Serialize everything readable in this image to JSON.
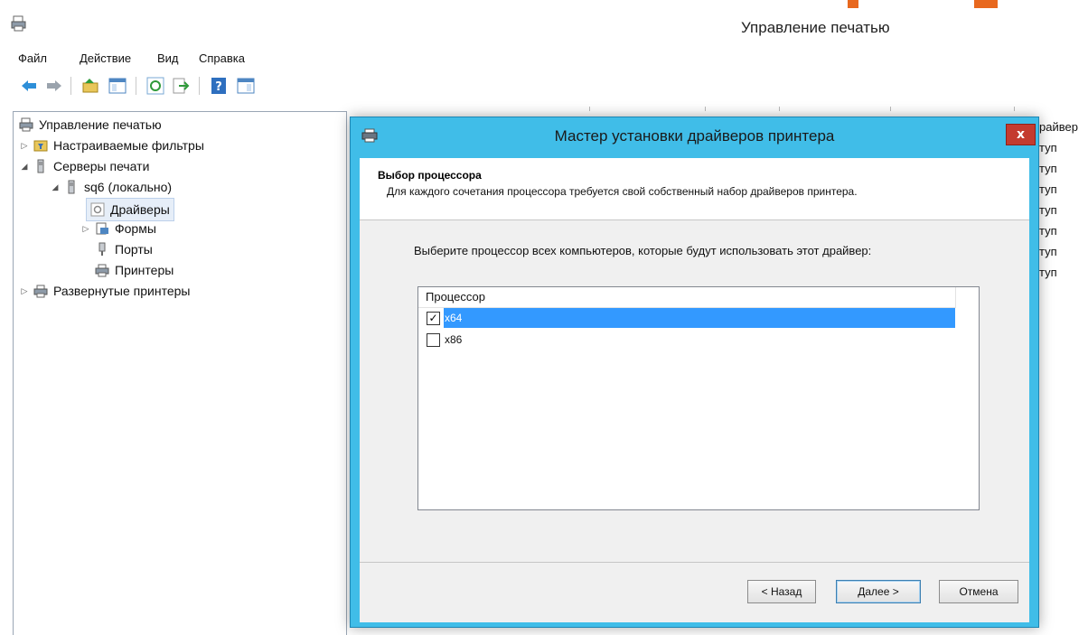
{
  "window": {
    "title": "Управление печатью"
  },
  "menu": [
    "Файл",
    "Действие",
    "Вид",
    "Справка"
  ],
  "tree": {
    "root": "Управление печатью",
    "custom_filters": "Настраиваемые фильтры",
    "print_servers": "Серверы печати",
    "server": "sq6 (локально)",
    "drivers": "Драйверы",
    "forms": "Формы",
    "ports": "Порты",
    "printers": "Принтеры",
    "deployed_printers": "Развернутые принтеры"
  },
  "right_column": {
    "header_fragment": "райвер",
    "rows": [
      "туп",
      "туп",
      "туп",
      "туп",
      "туп",
      "туп",
      "туп"
    ]
  },
  "dialog": {
    "title": "Мастер установки драйверов принтера",
    "close_label": "x",
    "section_title": "Выбор процессора",
    "section_desc": "Для каждого сочетания процессора требуется свой собственный набор драйверов принтера.",
    "instruction": "Выберите процессор всех компьютеров, которые будут использовать этот драйвер:",
    "list_header": "Процессор",
    "options": [
      {
        "label": "x64",
        "checked": true,
        "selected": true
      },
      {
        "label": "x86",
        "checked": false,
        "selected": false
      }
    ],
    "buttons": {
      "back": "< Назад",
      "next": "Далее >",
      "cancel": "Отмена"
    }
  },
  "colors": {
    "dialog_frame": "#40bde8",
    "selection": "#3399ff",
    "close_button": "#c43b2f",
    "accent": "#e8681e"
  }
}
